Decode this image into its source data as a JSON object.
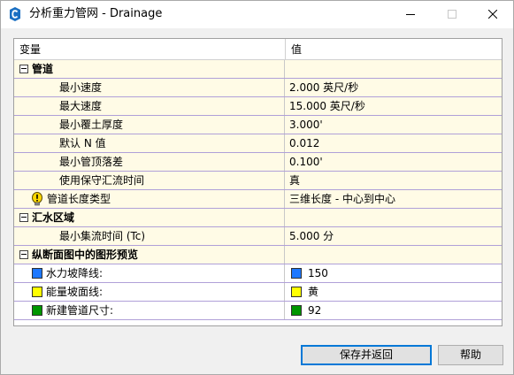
{
  "window": {
    "title": "分析重力管网 - Drainage",
    "app_icon": "civil3d-icon"
  },
  "grid": {
    "col_variable": "变量",
    "col_value": "值",
    "pipes_category": "管道",
    "min_velocity_label": "最小速度",
    "min_velocity_value": "2.000 英尺/秒",
    "max_velocity_label": "最大速度",
    "max_velocity_value": "15.000 英尺/秒",
    "min_cover_label": "最小覆土厚度",
    "min_cover_value": "3.000'",
    "default_n_label": "默认 N 值",
    "default_n_value": "0.012",
    "min_drop_label": "最小管顶落差",
    "min_drop_value": "0.100'",
    "conservative_label": "使用保守汇流时间",
    "conservative_value": "真",
    "pipe_length_label": "管道长度类型",
    "pipe_length_value": "三维长度  -  中心到中心",
    "catchment_category": "汇水区域",
    "min_tc_label": "最小集流时间 (Tc)",
    "min_tc_value": "5.000 分",
    "profile_category": "纵断面图中的图形预览",
    "hgl_label": "水力坡降线:",
    "hgl_value": "150",
    "egl_label": "能量坡面线:",
    "egl_value": "黄",
    "new_pipe_label": "新建管道尺寸:",
    "new_pipe_value": "92"
  },
  "colors": {
    "hgl": "#1e78ff",
    "egl": "#ffff00",
    "new_pipe": "#009600",
    "accent": "#0078d7"
  },
  "buttons": {
    "save_return": "保存并返回",
    "help": "帮助"
  }
}
